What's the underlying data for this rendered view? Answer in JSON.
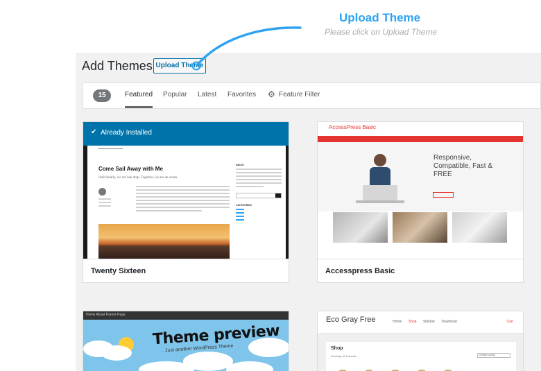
{
  "callout": {
    "title": "Upload Theme",
    "subtitle": "Please click on Upload Theme"
  },
  "header": {
    "title": "Add Themes",
    "upload_button": "Upload Theme"
  },
  "filters": {
    "count": "15",
    "tabs": [
      {
        "label": "Featured",
        "active": true
      },
      {
        "label": "Popular",
        "active": false
      },
      {
        "label": "Latest",
        "active": false
      },
      {
        "label": "Favorites",
        "active": false
      }
    ],
    "feature_filter": "Feature Filter",
    "feature_filter_icon": "gear-icon"
  },
  "themes": [
    {
      "name": "Twenty Sixteen",
      "installed_label": "Already Installed",
      "installed_icon": "checkmark-icon",
      "preview": {
        "post_title": "Come Sail Away with Me",
        "excerpt": "Individually, we are one drop. Together, we are an ocean.",
        "sidebar_heading_1": "ABOUT",
        "sidebar_heading_2": "CATEGORIES"
      }
    },
    {
      "name": "Accesspress Basic",
      "preview": {
        "logo": "AccessPress Basic",
        "headline": "Responsive, Compatible, Fast & FREE"
      }
    },
    {
      "name": "",
      "preview": {
        "nav": "Home   About   Parent Page",
        "title": "Theme preview",
        "subtitle": "Just another WordPress Theme"
      }
    },
    {
      "name": "",
      "preview": {
        "logo": "Eco Gray Free",
        "nav": [
          "Home",
          "Shop",
          "Sidebar",
          "Download"
        ],
        "cart": "Cart",
        "shop_heading": "Shop",
        "showing": "Showing all 6 results",
        "sort": "Default sorting"
      }
    }
  ],
  "colors": {
    "accent": "#2ea3f2",
    "wp_blue": "#0073aa",
    "background": "#f1f1f1",
    "red": "#e3342f"
  }
}
